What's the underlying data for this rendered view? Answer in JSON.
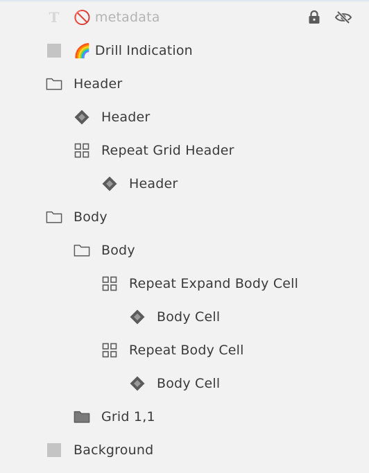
{
  "layers": {
    "metadata": {
      "emoji": "🚫",
      "label": "metadata"
    },
    "drill_indication": {
      "emoji": "🌈",
      "label": "Drill Indication"
    },
    "header_group": {
      "label": "Header"
    },
    "header_component": {
      "label": "Header"
    },
    "repeat_grid_header": {
      "label": "Repeat Grid Header"
    },
    "header_nested_component": {
      "label": "Header"
    },
    "body_group": {
      "label": "Body"
    },
    "body_subgroup": {
      "label": "Body"
    },
    "repeat_expand_body_cell": {
      "label": "Repeat Expand Body Cell"
    },
    "body_cell_1": {
      "label": "Body Cell"
    },
    "repeat_body_cell": {
      "label": "Repeat Body Cell"
    },
    "body_cell_2": {
      "label": "Body Cell"
    },
    "grid_1_1": {
      "label": "Grid 1,1"
    },
    "background": {
      "label": "Background"
    }
  },
  "icons": {
    "text": "text-layer-icon",
    "rectangle": "rectangle-icon",
    "folder": "folder-icon",
    "folder_filled": "folder-filled-icon",
    "component": "component-instance-icon",
    "repeat_grid": "repeat-grid-icon",
    "lock": "lock-icon",
    "hidden": "eye-hidden-icon"
  },
  "colors": {
    "background": "#f2f2f2",
    "text": "#3a3a3a",
    "dim_text": "#b4b4b4",
    "icon": "#5b5b5b",
    "rect_fill": "#c4c4c4"
  }
}
